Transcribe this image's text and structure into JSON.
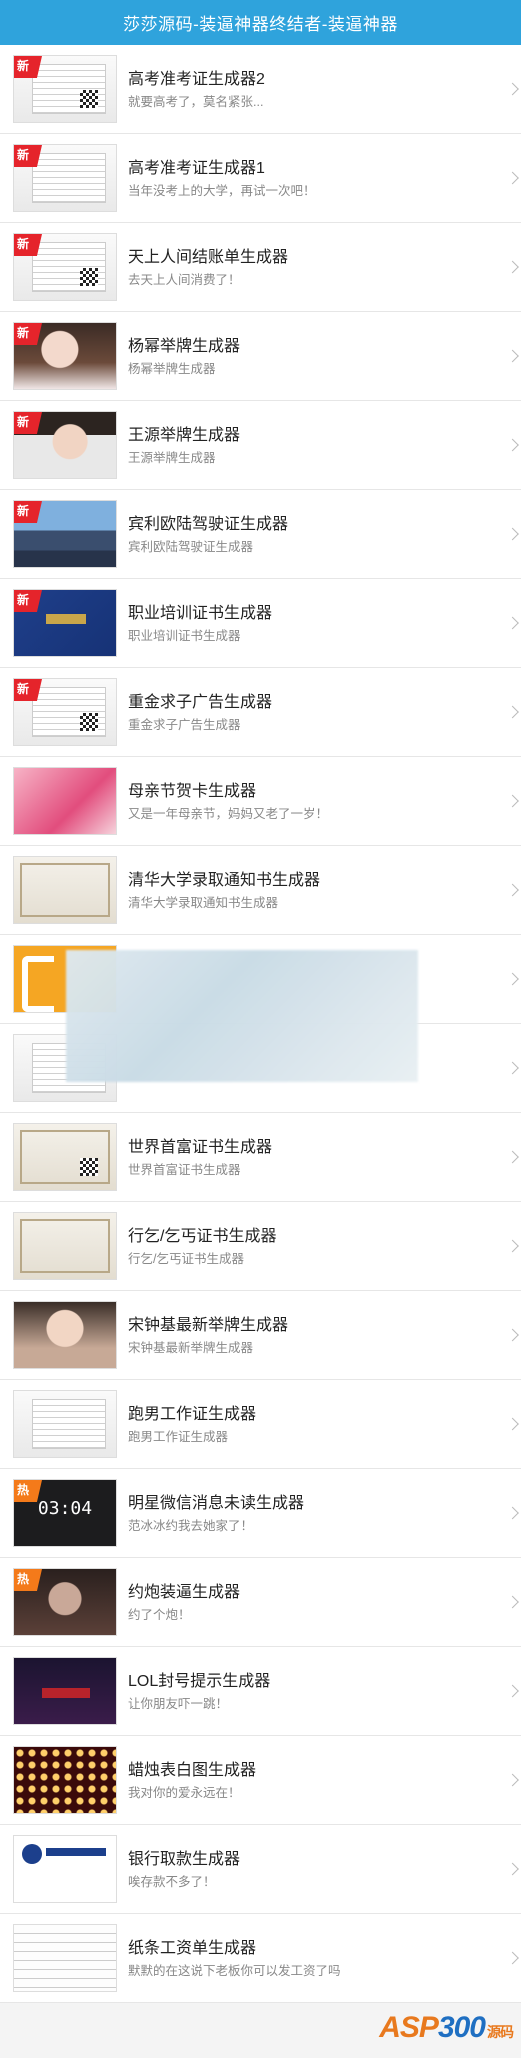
{
  "header": {
    "title": "莎莎源码-装逼神器终结者-装逼神器"
  },
  "items": [
    {
      "title": "高考准考证生成器2",
      "sub": "就要高考了，莫名紧张...",
      "badge": "新",
      "icon": "admission-ticket-image"
    },
    {
      "title": "高考准考证生成器1",
      "sub": "当年没考上的大学，再试一次吧！",
      "badge": "新",
      "icon": "admission-ticket-image"
    },
    {
      "title": "天上人间结账单生成器",
      "sub": "去天上人间消费了！",
      "badge": "新",
      "icon": "receipt-image"
    },
    {
      "title": "杨幂举牌生成器",
      "sub": "杨幂举牌生成器",
      "badge": "新",
      "icon": "celebrity-photo"
    },
    {
      "title": "王源举牌生成器",
      "sub": "王源举牌生成器",
      "badge": "新",
      "icon": "celebrity-photo"
    },
    {
      "title": "宾利欧陆驾驶证生成器",
      "sub": "宾利欧陆驾驶证生成器",
      "badge": "新",
      "icon": "car-photo"
    },
    {
      "title": "职业培训证书生成器",
      "sub": "职业培训证书生成器",
      "badge": "新",
      "icon": "certificate-book-image"
    },
    {
      "title": "重金求子广告生成器",
      "sub": "重金求子广告生成器",
      "badge": "新",
      "icon": "ad-poster-image"
    },
    {
      "title": "母亲节贺卡生成器",
      "sub": "又是一年母亲节，妈妈又老了一岁！",
      "badge": "",
      "icon": "greeting-card-image"
    },
    {
      "title": "清华大学录取通知书生成器",
      "sub": "清华大学录取通知书生成器",
      "badge": "",
      "icon": "admission-letter-image"
    },
    {
      "title": "",
      "sub": "",
      "badge": "",
      "icon": "orange-app-logo"
    },
    {
      "title": "",
      "sub": "",
      "badge": "",
      "icon": "photo-thumbnail"
    },
    {
      "title": "世界首富证书生成器",
      "sub": "世界首富证书生成器",
      "badge": "",
      "icon": "certificate-image"
    },
    {
      "title": "行乞/乞丐证书生成器",
      "sub": "行乞/乞丐证书生成器",
      "badge": "",
      "icon": "certificate-image"
    },
    {
      "title": "宋钟基最新举牌生成器",
      "sub": "宋钟基最新举牌生成器",
      "badge": "",
      "icon": "celebrity-photo"
    },
    {
      "title": "跑男工作证生成器",
      "sub": "跑男工作证生成器",
      "badge": "",
      "icon": "work-badge-image"
    },
    {
      "title": "明星微信消息未读生成器",
      "sub": "范冰冰约我去她家了！",
      "badge": "热",
      "icon": "phone-lockscreen-image",
      "time": "03:04"
    },
    {
      "title": "约炮装逼生成器",
      "sub": "约了个炮！",
      "badge": "热",
      "icon": "portrait-photo"
    },
    {
      "title": "LOL封号提示生成器",
      "sub": "让你朋友吓一跳！",
      "badge": "",
      "icon": "game-screen-image"
    },
    {
      "title": "蜡烛表白图生成器",
      "sub": "我对你的爱永远在！",
      "badge": "",
      "icon": "candle-heart-image"
    },
    {
      "title": "银行取款生成器",
      "sub": "唉存款不多了！",
      "badge": "",
      "icon": "bank-slip-image"
    },
    {
      "title": "纸条工资单生成器",
      "sub": "默默的在这说下老板你可以发工资了吗",
      "badge": "",
      "icon": "paper-note-image"
    }
  ],
  "footer": {
    "watermark_brand": "ASP",
    "watermark_num": "300",
    "watermark_tail": "源码"
  }
}
